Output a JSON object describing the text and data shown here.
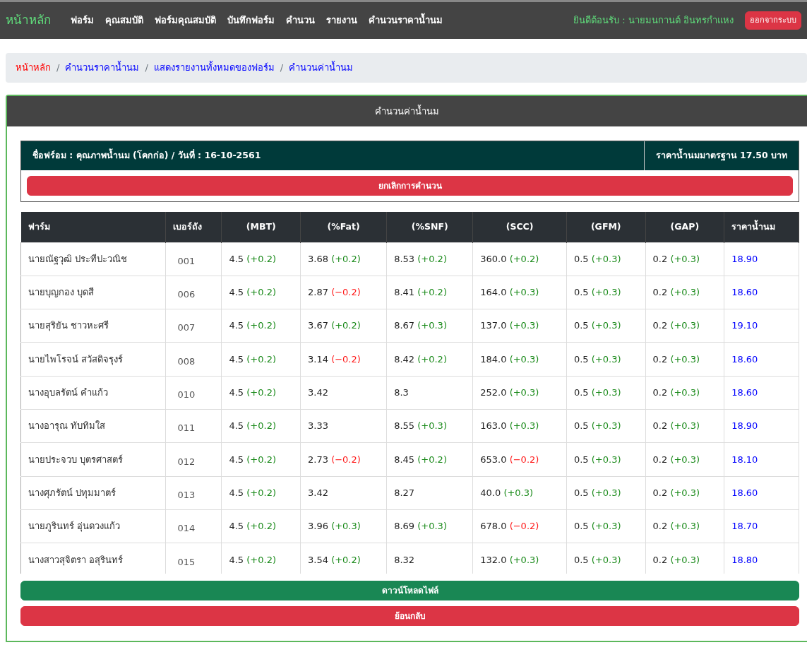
{
  "navbar": {
    "brand": "หน้าหลัก",
    "items": [
      "ฟอร์ม",
      "คุณสมบัติ",
      "ฟอร์มคุณสมบัติ",
      "บันทึกฟอร์ม",
      "คำนวน",
      "รายงาน",
      "คำนวนราคาน้ำนม"
    ],
    "welcome": "ยินดีต้อนรับ : นายมนกานต์ อินทรกำแหง",
    "logout": "ออกจากระบบ"
  },
  "breadcrumb": [
    {
      "label": "หน้าหลัก",
      "color": "#ff0000"
    },
    {
      "separator_before": "/",
      "label": "คำนวนราคาน้ำนม",
      "color": "#0000ff"
    },
    {
      "separator_before": "/",
      "label": "แสดงรายงานทั้งหมดของฟอร์ม",
      "color": "#0000ff"
    },
    {
      "separator_before": "/",
      "label": "คำนวนค่าน้ำนม",
      "color": "#0000ff"
    }
  ],
  "card": {
    "title": "คำนวนค่าน้ำนม",
    "info": {
      "form": "ชื่อฟร์อม : คุณภาพน้ำนม (โคกก่อ) / วันที่ : 16-10-2561",
      "standard_price": "ราคาน้ำนมมาตรฐาน 17.50 บาท",
      "cancel_button": "ยกเลิกการคำนวน"
    },
    "table": {
      "columns": [
        "ฟาร์ม",
        "เบอร์ถัง",
        "(MBT)",
        "(%Fat)",
        "(%SNF)",
        "(SCC)",
        "(GFM)",
        "(GAP)",
        "ราคาน้ำนม"
      ],
      "rows": [
        {
          "farm": "นายณัฐวุฒิ ประทีปะวณิช",
          "tank": "001",
          "measures": [
            {
              "value": "4.5",
              "delta": "(+0.2)",
              "negative": false
            },
            {
              "value": "3.68",
              "delta": "(+0.2)",
              "negative": false
            },
            {
              "value": "8.53",
              "delta": "(+0.2)",
              "negative": false
            },
            {
              "value": "360.0",
              "delta": "(+0.2)",
              "negative": false
            },
            {
              "value": "0.5",
              "delta": "(+0.3)",
              "negative": false
            },
            {
              "value": "0.2",
              "delta": "(+0.3)",
              "negative": false
            }
          ],
          "price": "18.90"
        },
        {
          "farm": "นายบุญกอง บุดสี",
          "tank": "006",
          "measures": [
            {
              "value": "4.5",
              "delta": "(+0.2)",
              "negative": false
            },
            {
              "value": "2.87",
              "delta": "(−0.2)",
              "negative": true
            },
            {
              "value": "8.41",
              "delta": "(+0.2)",
              "negative": false
            },
            {
              "value": "164.0",
              "delta": "(+0.3)",
              "negative": false
            },
            {
              "value": "0.5",
              "delta": "(+0.3)",
              "negative": false
            },
            {
              "value": "0.2",
              "delta": "(+0.3)",
              "negative": false
            }
          ],
          "price": "18.60"
        },
        {
          "farm": "นายสุริยัน ชาวหะศรี",
          "tank": "007",
          "measures": [
            {
              "value": "4.5",
              "delta": "(+0.2)",
              "negative": false
            },
            {
              "value": "3.67",
              "delta": "(+0.2)",
              "negative": false
            },
            {
              "value": "8.67",
              "delta": "(+0.3)",
              "negative": false
            },
            {
              "value": "137.0",
              "delta": "(+0.3)",
              "negative": false
            },
            {
              "value": "0.5",
              "delta": "(+0.3)",
              "negative": false
            },
            {
              "value": "0.2",
              "delta": "(+0.3)",
              "negative": false
            }
          ],
          "price": "19.10"
        },
        {
          "farm": "นายไพโรจน์ สวัสดิจรุงร์",
          "tank": "008",
          "measures": [
            {
              "value": "4.5",
              "delta": "(+0.2)",
              "negative": false
            },
            {
              "value": "3.14",
              "delta": "(−0.2)",
              "negative": true
            },
            {
              "value": "8.42",
              "delta": "(+0.2)",
              "negative": false
            },
            {
              "value": "184.0",
              "delta": "(+0.3)",
              "negative": false
            },
            {
              "value": "0.5",
              "delta": "(+0.3)",
              "negative": false
            },
            {
              "value": "0.2",
              "delta": "(+0.3)",
              "negative": false
            }
          ],
          "price": "18.60"
        },
        {
          "farm": "นางอุบลรัตน์ คำแก้ว",
          "tank": "010",
          "measures": [
            {
              "value": "4.5",
              "delta": "(+0.2)",
              "negative": false
            },
            {
              "value": "3.42"
            },
            {
              "value": "8.3"
            },
            {
              "value": "252.0",
              "delta": "(+0.3)",
              "negative": false
            },
            {
              "value": "0.5",
              "delta": "(+0.3)",
              "negative": false
            },
            {
              "value": "0.2",
              "delta": "(+0.3)",
              "negative": false
            }
          ],
          "price": "18.60"
        },
        {
          "farm": "นางอารุณ ทับทิมใส",
          "tank": "011",
          "measures": [
            {
              "value": "4.5",
              "delta": "(+0.2)",
              "negative": false
            },
            {
              "value": "3.33"
            },
            {
              "value": "8.55",
              "delta": "(+0.3)",
              "negative": false
            },
            {
              "value": "163.0",
              "delta": "(+0.3)",
              "negative": false
            },
            {
              "value": "0.5",
              "delta": "(+0.3)",
              "negative": false
            },
            {
              "value": "0.2",
              "delta": "(+0.3)",
              "negative": false
            }
          ],
          "price": "18.90"
        },
        {
          "farm": "นายประจวบ บุตรศาสตร์",
          "tank": "012",
          "measures": [
            {
              "value": "4.5",
              "delta": "(+0.2)",
              "negative": false
            },
            {
              "value": "2.73",
              "delta": "(−0.2)",
              "negative": true
            },
            {
              "value": "8.45",
              "delta": "(+0.2)",
              "negative": false
            },
            {
              "value": "653.0",
              "delta": "(−0.2)",
              "negative": true
            },
            {
              "value": "0.5",
              "delta": "(+0.3)",
              "negative": false
            },
            {
              "value": "0.2",
              "delta": "(+0.3)",
              "negative": false
            }
          ],
          "price": "18.10"
        },
        {
          "farm": "นางศุภรัตน์ ปทุมมาตร์",
          "tank": "013",
          "measures": [
            {
              "value": "4.5",
              "delta": "(+0.2)",
              "negative": false
            },
            {
              "value": "3.42"
            },
            {
              "value": "8.27"
            },
            {
              "value": "40.0",
              "delta": "(+0.3)",
              "negative": false
            },
            {
              "value": "0.5",
              "delta": "(+0.3)",
              "negative": false
            },
            {
              "value": "0.2",
              "delta": "(+0.3)",
              "negative": false
            }
          ],
          "price": "18.60"
        },
        {
          "farm": "นายภูรินทร์ อุ่นดวงแก้ว",
          "tank": "014",
          "measures": [
            {
              "value": "4.5",
              "delta": "(+0.2)",
              "negative": false
            },
            {
              "value": "3.96",
              "delta": "(+0.3)",
              "negative": false
            },
            {
              "value": "8.69",
              "delta": "(+0.3)",
              "negative": false
            },
            {
              "value": "678.0",
              "delta": "(−0.2)",
              "negative": true
            },
            {
              "value": "0.5",
              "delta": "(+0.3)",
              "negative": false
            },
            {
              "value": "0.2",
              "delta": "(+0.3)",
              "negative": false
            }
          ],
          "price": "18.70"
        },
        {
          "farm": "นางสาวสุจิตรา อสุรินทร์",
          "tank": "015",
          "measures": [
            {
              "value": "4.5",
              "delta": "(+0.2)",
              "negative": false
            },
            {
              "value": "3.54",
              "delta": "(+0.2)",
              "negative": false
            },
            {
              "value": "8.32"
            },
            {
              "value": "132.0",
              "delta": "(+0.3)",
              "negative": false
            },
            {
              "value": "0.5",
              "delta": "(+0.3)",
              "negative": false
            },
            {
              "value": "0.2",
              "delta": "(+0.3)",
              "negative": false
            }
          ],
          "price": "18.80"
        }
      ]
    },
    "download_button": "ดาวน์โหลดไฟล์",
    "back_button": "ย้อนกลับ"
  }
}
